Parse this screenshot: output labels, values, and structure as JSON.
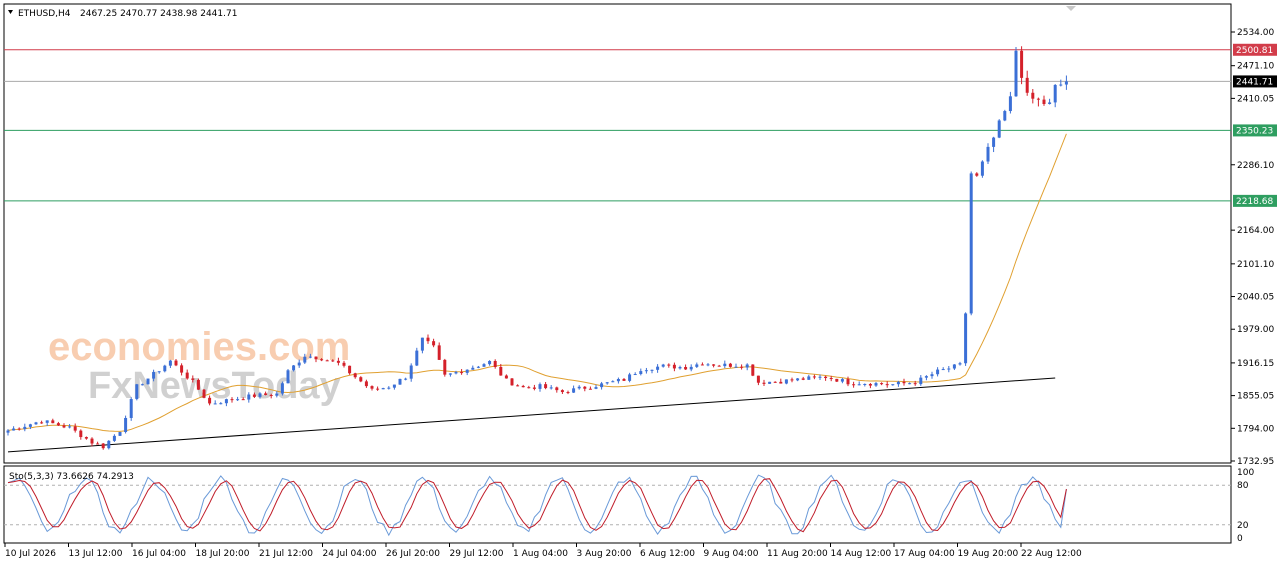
{
  "header": {
    "symbol": "ETHUSD,H4",
    "ohlc": "2467.25 2470.77 2438.98 2441.71"
  },
  "watermark": {
    "line1": "economies.com",
    "line2": "FxNewsToday"
  },
  "colors": {
    "bull": "#3b6fd6",
    "bear": "#d4202a",
    "ma": "#e0a030",
    "trend": "#000000",
    "resistance": "#d23c4a",
    "support": "#2e9e60",
    "price": "#aaaaaa",
    "stoch_main": "#6a9ad8",
    "stoch_signal": "#c01d2a"
  },
  "chart_data": {
    "type": "candlestick",
    "y_ticks": [
      "2534.00",
      "2471.10",
      "2410.05",
      "2286.10",
      "2164.00",
      "2101.10",
      "2040.05",
      "1979.00",
      "1916.15",
      "1855.05",
      "1794.00",
      "1732.95"
    ],
    "ylim": [
      1732.95,
      2534.0
    ],
    "x_labels": [
      "10 Jul 2026",
      "13 Jul 12:00",
      "16 Jul 04:00",
      "18 Jul 20:00",
      "21 Jul 12:00",
      "24 Jul 04:00",
      "26 Jul 20:00",
      "29 Jul 12:00",
      "1 Aug 04:00",
      "3 Aug 20:00",
      "6 Aug 12:00",
      "9 Aug 04:00",
      "11 Aug 20:00",
      "14 Aug 12:00",
      "17 Aug 04:00",
      "19 Aug 20:00",
      "22 Aug 12:00"
    ],
    "levels": [
      {
        "label": "2500.81",
        "value": 2500.81,
        "kind": "resistance"
      },
      {
        "label": "2441.71",
        "value": 2441.71,
        "kind": "price"
      },
      {
        "label": "2350.23",
        "value": 2350.23,
        "kind": "support"
      },
      {
        "label": "2218.68",
        "value": 2218.68,
        "kind": "support"
      }
    ],
    "trendline": [
      [
        0,
        1750.0
      ],
      [
        187,
        1888.0
      ]
    ],
    "close_anchors": [
      [
        0,
        1790
      ],
      [
        6,
        1808
      ],
      [
        11,
        1795
      ],
      [
        15,
        1768
      ],
      [
        17,
        1760
      ],
      [
        20,
        1790
      ],
      [
        23,
        1872
      ],
      [
        26,
        1895
      ],
      [
        29,
        1920
      ],
      [
        33,
        1880
      ],
      [
        36,
        1840
      ],
      [
        40,
        1848
      ],
      [
        44,
        1855
      ],
      [
        48,
        1858
      ],
      [
        50,
        1900
      ],
      [
        53,
        1930
      ],
      [
        56,
        1925
      ],
      [
        59,
        1915
      ],
      [
        62,
        1890
      ],
      [
        65,
        1865
      ],
      [
        68,
        1872
      ],
      [
        71,
        1890
      ],
      [
        74,
        1960
      ],
      [
        76,
        1945
      ],
      [
        78,
        1892
      ],
      [
        82,
        1905
      ],
      [
        86,
        1918
      ],
      [
        89,
        1883
      ],
      [
        92,
        1870
      ],
      [
        95,
        1872
      ],
      [
        99,
        1862
      ],
      [
        102,
        1868
      ],
      [
        106,
        1876
      ],
      [
        110,
        1885
      ],
      [
        113,
        1905
      ],
      [
        117,
        1910
      ],
      [
        121,
        1908
      ],
      [
        124,
        1916
      ],
      [
        127,
        1912
      ],
      [
        132,
        1912
      ],
      [
        134,
        1880
      ],
      [
        138,
        1882
      ],
      [
        142,
        1886
      ],
      [
        146,
        1890
      ],
      [
        150,
        1880
      ],
      [
        154,
        1878
      ],
      [
        158,
        1876
      ],
      [
        162,
        1880
      ],
      [
        166,
        1900
      ],
      [
        170,
        1912
      ],
      [
        171,
        2010
      ],
      [
        172,
        2270
      ],
      [
        173,
        2262
      ],
      [
        175,
        2312
      ],
      [
        177,
        2360
      ],
      [
        179,
        2408
      ],
      [
        180,
        2500
      ],
      [
        182,
        2412
      ],
      [
        184,
        2405
      ],
      [
        186,
        2398
      ],
      [
        187,
        2430
      ],
      [
        189,
        2441.71
      ]
    ],
    "stochastic": {
      "label": "Sto(5,3,3) 73.6626 74.2913",
      "main": 73.6626,
      "signal": 74.2913,
      "ylim": [
        0,
        100
      ],
      "y_ticks": [
        "100",
        "80",
        "20",
        "0"
      ],
      "levels": [
        80,
        20
      ]
    }
  }
}
